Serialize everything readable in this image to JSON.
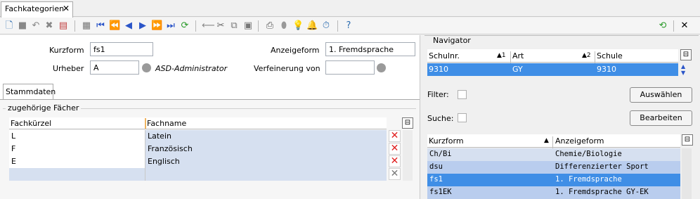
{
  "tab": {
    "title": "Fachkategorien",
    "close": "✕"
  },
  "toolbar_right": {
    "close": "✕"
  },
  "form": {
    "kurzform_label": "Kurzform",
    "kurzform_value": "fs1",
    "anzeigeform_label": "Anzeigeform",
    "anzeigeform_value": "1. Fremdsprache",
    "urheber_label": "Urheber",
    "urheber_value": "A",
    "urheber_desc": "ASD-Administrator",
    "verfeinerung_label": "Verfeinerung von",
    "verfeinerung_value": ""
  },
  "inner_tab": "Stammdaten",
  "group_title": "zugehörige Fächer",
  "subjects": {
    "headers": [
      "Fachkürzel",
      "Fachname"
    ],
    "rows": [
      {
        "kuerzel": "L",
        "name": "Latein"
      },
      {
        "kuerzel": "F",
        "name": "Französisch"
      },
      {
        "kuerzel": "E",
        "name": "Englisch"
      }
    ]
  },
  "navigator": {
    "title": "Navigator",
    "headers": [
      "Schulnr.",
      "Art",
      "Schule"
    ],
    "sort_marks": [
      "▲1",
      "▲2"
    ],
    "row": [
      "9310",
      "GY",
      "9310"
    ],
    "filter_label": "Filter:",
    "suche_label": "Suche:",
    "auswaehlen": "Auswählen",
    "bearbeiten": "Bearbeiten"
  },
  "list": {
    "headers": [
      "Kurzform",
      "Anzeigeform"
    ],
    "rows": [
      {
        "kurzform": "Ch/Bi",
        "anzeigeform": "Chemie/Biologie"
      },
      {
        "kurzform": "dsu",
        "anzeigeform": "Differenzierter Sport"
      },
      {
        "kurzform": "fs1",
        "anzeigeform": "1. Fremdsprache"
      },
      {
        "kurzform": "fs1EK",
        "anzeigeform": "1. Fremdsprache GY-EK"
      }
    ]
  },
  "colors": {
    "selection": "#3f8ee6",
    "row_tint": "#d6e0f0",
    "delete_red": "#e02020"
  }
}
